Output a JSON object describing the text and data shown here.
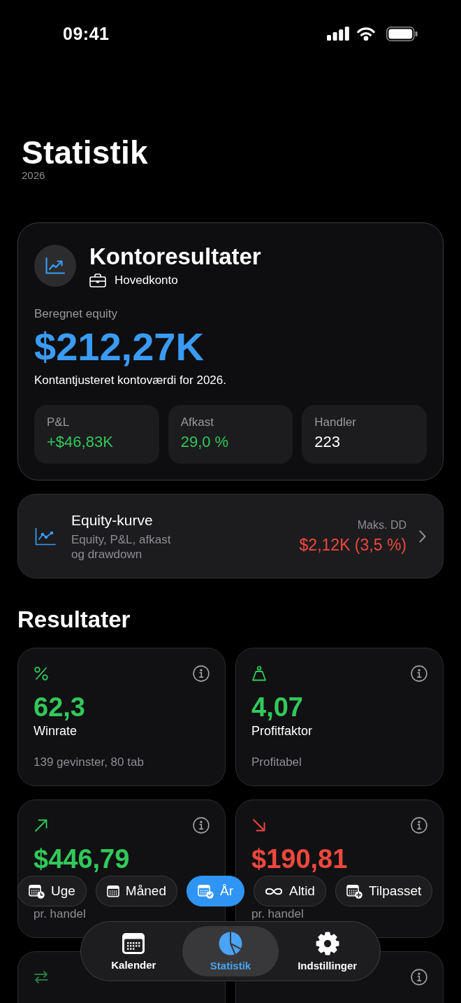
{
  "status_bar": {
    "time": "09:41"
  },
  "header": {
    "title": "Statistik",
    "subtitle": "2026"
  },
  "account_card": {
    "title": "Kontoresultater",
    "account": "Hovedkonto",
    "equity_label": "Beregnet equity",
    "equity_value": "$212,27K",
    "note": "Kontantjusteret kontoværdi for 2026.",
    "stats": [
      {
        "label": "P&L",
        "value": "+$46,83K",
        "color": "#32c85a"
      },
      {
        "label": "Afkast",
        "value": "29,0 %",
        "color": "#32c85a"
      },
      {
        "label": "Handler",
        "value": "223",
        "color": "#ffffff"
      }
    ]
  },
  "equity_curve": {
    "title": "Equity-kurve",
    "subtitle": "Equity, P&L, afkast og drawdown",
    "max_dd_label": "Maks. DD",
    "max_dd_value": "$2,12K (3,5 %)"
  },
  "results": {
    "heading": "Resultater",
    "metrics": [
      {
        "kind": "percent",
        "color": "#32c85a",
        "value": "62,3",
        "label": "Winrate",
        "note": "139 gevinster, 80 tab",
        "info": true
      },
      {
        "kind": "weight",
        "color": "#32c85a",
        "value": "4,07",
        "label": "Profitfaktor",
        "note": "Profitabel",
        "info": true
      },
      {
        "kind": "rise",
        "color": "#32c85a",
        "value": "$446,79",
        "note": "pr. handel",
        "info": true
      },
      {
        "kind": "fall",
        "color": "#f0483e",
        "value": "$190,81",
        "note": "pr. handel",
        "info": true
      },
      {
        "kind": "swap",
        "color": "#2a7a42",
        "info": false
      },
      {
        "info": true
      }
    ]
  },
  "periods": [
    {
      "kind": "week",
      "label": "Uge",
      "selected": false
    },
    {
      "kind": "month",
      "label": "Måned",
      "selected": false
    },
    {
      "kind": "year",
      "label": "År",
      "selected": true
    },
    {
      "kind": "all",
      "label": "Altid",
      "selected": false
    },
    {
      "kind": "custom",
      "label": "Tilpasset",
      "selected": false
    }
  ],
  "tabs": [
    {
      "kind": "calendar",
      "label": "Kalender",
      "selected": false
    },
    {
      "kind": "pie",
      "label": "Statistik",
      "selected": true
    },
    {
      "kind": "gear",
      "label": "Indstillinger",
      "selected": false
    }
  ]
}
